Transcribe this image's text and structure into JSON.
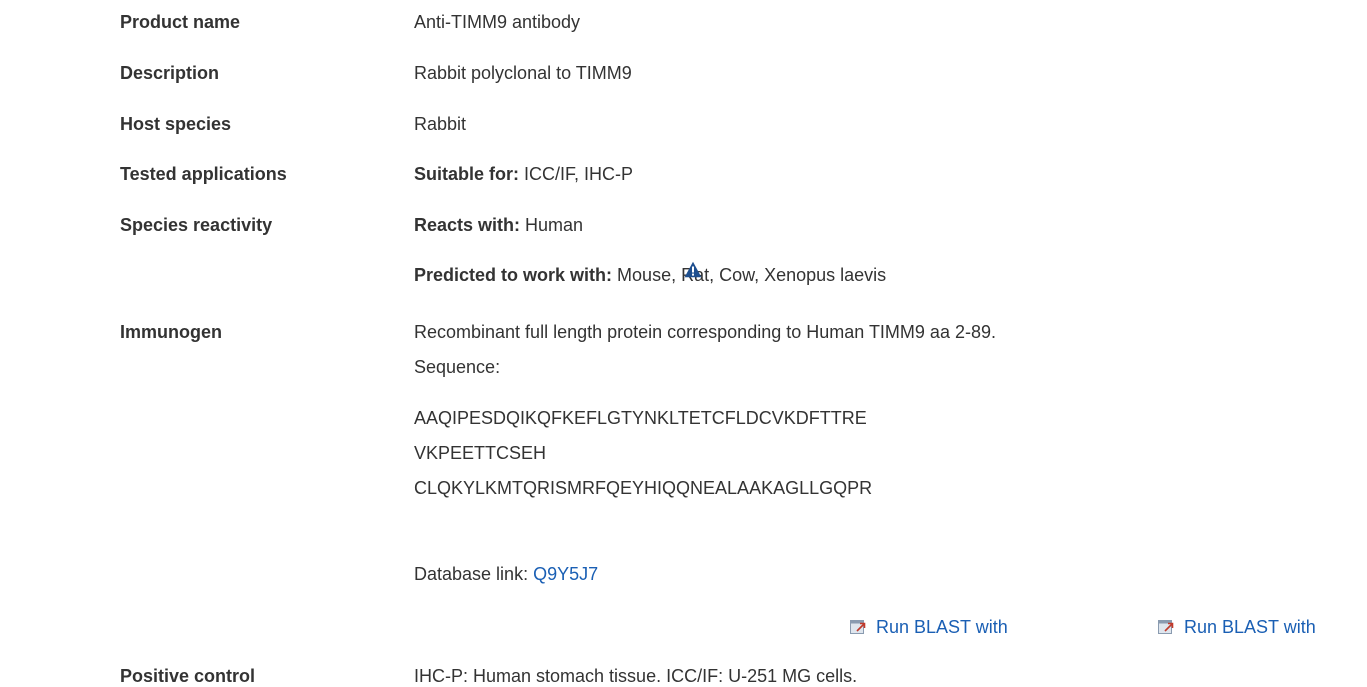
{
  "rows": {
    "product_name": {
      "label": "Product name",
      "value": "Anti-TIMM9 antibody"
    },
    "description": {
      "label": "Description",
      "value": "Rabbit polyclonal to TIMM9"
    },
    "host_species": {
      "label": "Host species",
      "value": "Rabbit"
    },
    "tested_applications": {
      "label": "Tested applications",
      "prefix": "Suitable for:",
      "value": "ICC/IF, IHC-P"
    },
    "species_reactivity": {
      "label": "Species reactivity",
      "reacts_prefix": "Reacts with:",
      "reacts_value": "Human",
      "predicted_prefix": "Predicted to work with:",
      "predicted_value": "Mouse, Rat, Cow, Xenopus laevis",
      "warning_icon": "warning-triangle-icon"
    },
    "immunogen": {
      "label": "Immunogen",
      "line1": "Recombinant full length protein corresponding to Human TIMM9 aa 2-89.",
      "sequence_label": "Sequence:",
      "sequence_lines": [
        "AAQIPESDQIKQFKEFLGTYNKLTETCFLDCVKDFTTRE",
        "VKPEETTCSEH",
        "CLQKYLKMTQRISMRFQEYHIQQNEALAAKAGLLGQPR"
      ],
      "db_prefix": "Database link:",
      "db_link": "Q9Y5J7",
      "blast_links": [
        "Run BLAST with",
        "Run BLAST with"
      ],
      "blast_icon": "external-window-icon"
    },
    "positive_control": {
      "label": "Positive control",
      "value": "IHC-P: Human stomach tissue. ICC/IF: U-251 MG cells."
    }
  },
  "colors": {
    "text": "#333333",
    "link": "#1a5fb4",
    "warning": "#1e4f8f"
  }
}
